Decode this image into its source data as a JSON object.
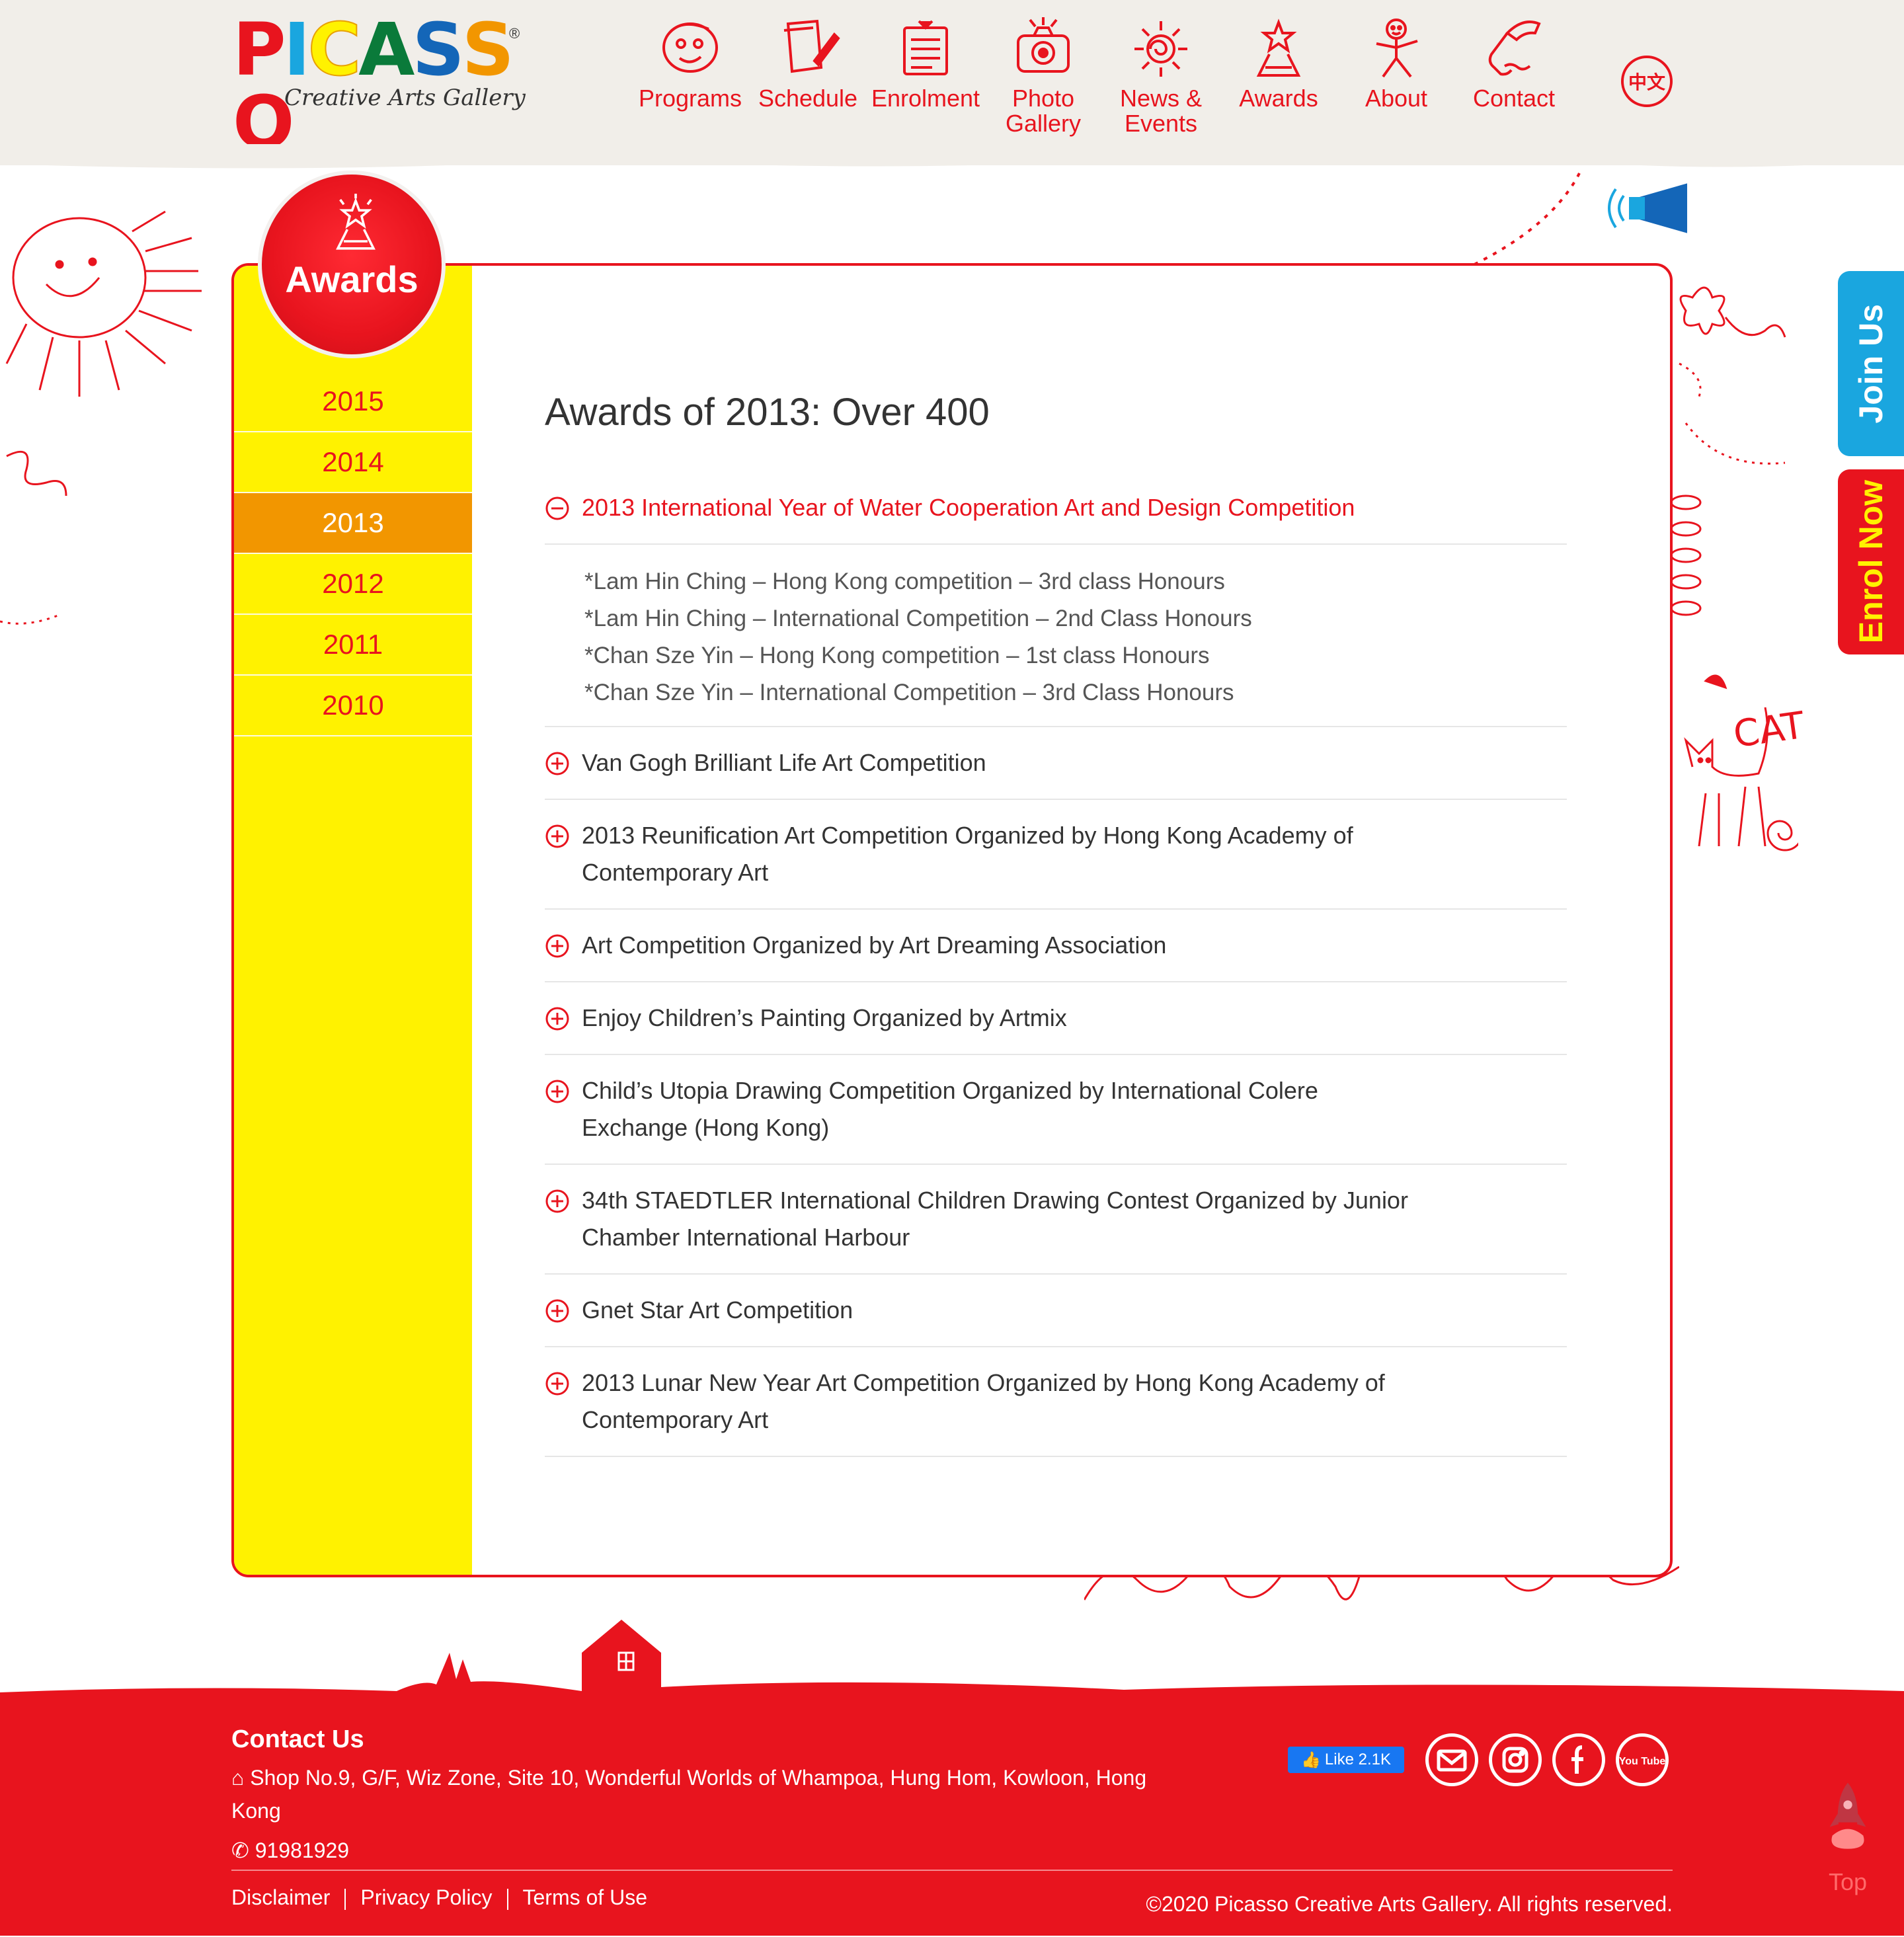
{
  "brand": {
    "logo_text": "PICASSO",
    "logo_subtitle": "Creative Arts Gallery",
    "registered_mark": "®"
  },
  "nav": {
    "items": [
      {
        "label": "Programs",
        "icon": "face-icon"
      },
      {
        "label": "Schedule",
        "icon": "paper-pen-icon"
      },
      {
        "label": "Enrolment",
        "icon": "form-icon"
      },
      {
        "label": "Photo Gallery",
        "icon": "camera-icon"
      },
      {
        "label": "News & Events",
        "icon": "sun-icon"
      },
      {
        "label": "Awards",
        "icon": "trophy-icon"
      },
      {
        "label": "About",
        "icon": "stick-figure-icon"
      },
      {
        "label": "Contact",
        "icon": "phone-icon"
      }
    ],
    "language_toggle": "中文"
  },
  "side_tabs": {
    "join": "Join Us",
    "enrol": "Enrol Now"
  },
  "section_badge": "Awards",
  "years": [
    "2015",
    "2014",
    "2013",
    "2012",
    "2011",
    "2010"
  ],
  "active_year": "2013",
  "page_title": "Awards of 2013: Over 400",
  "awards": [
    {
      "title": "2013 International Year of Water Cooperation Art and Design Competition",
      "open": true,
      "details": [
        "*Lam Hin Ching – Hong Kong competition – 3rd class Honours",
        "*Lam Hin Ching – International Competition – 2nd Class Honours",
        "*Chan Sze Yin – Hong Kong competition – 1st class Honours",
        "*Chan Sze Yin – International Competition – 3rd Class Honours"
      ]
    },
    {
      "title": "Van Gogh Brilliant Life Art Competition",
      "open": false
    },
    {
      "title": "2013 Reunification Art Competition Organized by Hong Kong Academy of Contemporary Art",
      "open": false
    },
    {
      "title": "Art Competition Organized by Art Dreaming Association",
      "open": false
    },
    {
      "title": "Enjoy Children’s Painting Organized by Artmix",
      "open": false
    },
    {
      "title": "Child’s Utopia Drawing Competition Organized by International Colere Exchange (Hong Kong)",
      "open": false
    },
    {
      "title": "34th STAEDTLER International Children Drawing Contest Organized by Junior Chamber International Harbour",
      "open": false
    },
    {
      "title": "Gnet Star Art Competition",
      "open": false
    },
    {
      "title": "2013 Lunar New Year Art Competition Organized by Hong Kong Academy of Contemporary Art",
      "open": false
    }
  ],
  "decor": {
    "cat_label": "CAT"
  },
  "footer": {
    "contact_title": "Contact Us",
    "address": "Shop No.9, G/F, Wiz Zone, Site 10, Wonderful Worlds of Whampoa, Hung Hom, Kowloon, Hong Kong",
    "phone": "91981929",
    "fb_like": "Like 2.1K",
    "social": [
      "email-icon",
      "instagram-icon",
      "facebook-icon",
      "youtube-icon"
    ],
    "youtube_text": "You Tube",
    "links": [
      "Disclaimer",
      "Privacy Policy",
      "Terms of Use"
    ],
    "copyright": "©2020 Picasso Creative Arts Gallery. All rights reserved.",
    "top_label": "Top"
  },
  "colors": {
    "brand_red": "#e8141e",
    "sidebar_yellow": "#fff200",
    "active_orange": "#f29600",
    "join_blue": "#1aa6df",
    "header_bg": "#f1eee9"
  }
}
